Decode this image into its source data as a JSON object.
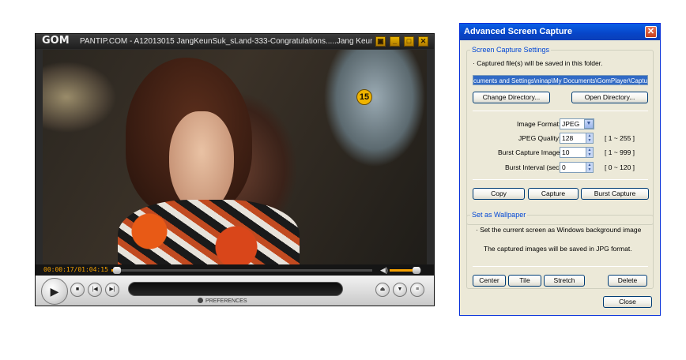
{
  "player": {
    "logo": "GOM",
    "title": "PANTIP.COM - A12013015 JangKeunSuk_sLand-333-Congratulations.....Jang Keun Suk Win Vote...",
    "window_buttons": [
      "▣",
      "_",
      "□",
      "✕"
    ],
    "overlay_badge": "15",
    "time": "00:00:17/01:04:15",
    "seek_progress": 0.02,
    "volume_level": 0.85,
    "preferences_label": "PREFERENCES",
    "colors": {
      "accent": "#f5a100",
      "chrome": "#2b2b2b"
    }
  },
  "dialog": {
    "title": "Advanced Screen Capture",
    "close_glyph": "✕",
    "capture_settings": {
      "group_label": "Screen Capture Settings",
      "info": "·  Captured file(s) will be saved in this folder.",
      "path": "cuments and Settings\\ninap\\My Documents\\GomPlayer\\Capture\\",
      "change_dir_button": "Change Directory...",
      "open_dir_button": "Open Directory...",
      "image_format_label": "Image Format:",
      "image_format_value": "JPEG",
      "jpeg_quality_label": "JPEG Quality:",
      "jpeg_quality_value": "128",
      "jpeg_quality_range": "[ 1 ~ 255 ]",
      "burst_images_label": "Burst Capture Images:",
      "burst_images_value": "10",
      "burst_images_range": "[ 1 ~ 999 ]",
      "burst_interval_label": "Burst Interval (sec):",
      "burst_interval_value": "0",
      "burst_interval_range": "[ 0 ~ 120 ]",
      "copy_button": "Copy",
      "capture_button": "Capture",
      "burst_capture_button": "Burst Capture"
    },
    "wallpaper": {
      "group_label": "Set as Wallpaper",
      "info1": "·   Set the current screen as Windows background image",
      "info2": "The captured images will be saved in JPG format.",
      "center_button": "Center",
      "tile_button": "Tile",
      "stretch_button": "Stretch",
      "delete_button": "Delete"
    },
    "close_button": "Close",
    "colors": {
      "titlebar": "#0a5fe5",
      "face": "#ece9d8",
      "group_label": "#0046d5",
      "selection": "#316ac5"
    }
  }
}
